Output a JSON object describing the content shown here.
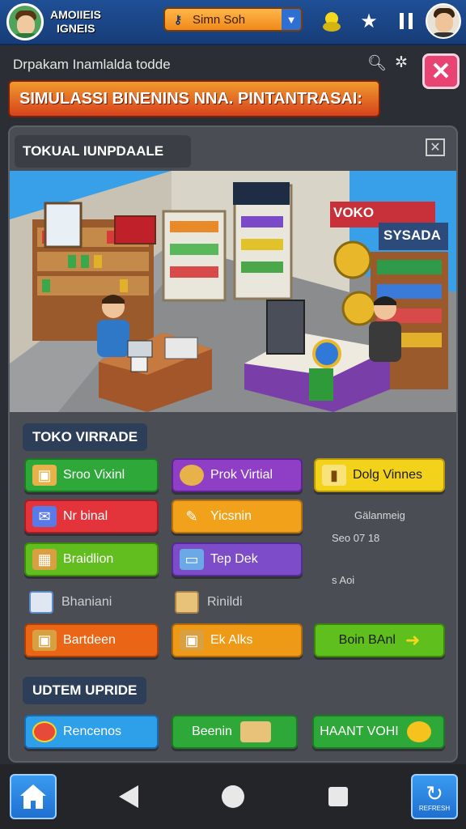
{
  "header": {
    "app_title_line1": "AMOIIEIS",
    "app_title_line2": "IGNEIS",
    "coin_label": "Simn Soh",
    "coin_icon": "key-icon",
    "icons": [
      "flame-icon",
      "star-icon",
      "pause-icon"
    ]
  },
  "subheader": {
    "text": "Drpakam Inamlalda todde",
    "banner": "SIMULASSI BINENINS NNA. PINTANTRASAI:"
  },
  "panel": {
    "title": "TOKUAL IUNPDAALE",
    "scene_signs": [
      "VOKO",
      "SYSADA"
    ]
  },
  "section1": {
    "label": "TOKO VIRRADE",
    "buttons": [
      {
        "label": "Sroo Vixinl",
        "color": "#2fa83a",
        "icon": "box-icon"
      },
      {
        "label": "Prok Virtial",
        "color": "#8e3fc6",
        "icon": "coin-stack-icon"
      },
      {
        "label": "Dolg Vinnes",
        "color": "#f2d21a",
        "icon": "bottle-icon"
      },
      {
        "label": "Nr binal",
        "color": "#e2343a",
        "icon": "mail-icon"
      },
      {
        "label": "Yicsnin",
        "color": "#f2a21a",
        "icon": "wrench-icon"
      },
      {
        "label": "Braidlion",
        "color": "#62bd1e",
        "icon": "crate-icon"
      },
      {
        "label": "Tep Dek",
        "color": "#7d4cc8",
        "icon": "picture-icon"
      },
      {
        "label": "Bartdeen",
        "color": "#ea6616",
        "icon": "box-open-icon"
      },
      {
        "label": "Ek Alks",
        "color": "#ef9a16",
        "icon": "package-icon"
      },
      {
        "label": "Boin BAnl",
        "color": "#5fbf1c",
        "icon": "arrow-right-icon"
      }
    ],
    "plain_items": [
      {
        "label": "Bhaniani",
        "icon": "document-icon"
      },
      {
        "label": "Rinildi",
        "icon": "bag-icon"
      }
    ],
    "stats": {
      "line1": "Gälanmeig",
      "line2": "Seo 07 18",
      "line3": "s Aoi"
    }
  },
  "section2": {
    "label": "UDTEM UPRIDE",
    "buttons": [
      {
        "label": "Rencenos",
        "color": "#2ea0ea",
        "icon": "badge-icon"
      },
      {
        "label": "Beenin",
        "color": "#2fa83a",
        "icon": "tag-icon"
      },
      {
        "label": "HAANT VOHI",
        "color": "#2fa83a",
        "icon": "coin-icon"
      }
    ]
  },
  "nav": {
    "refresh_label": "REFRESH",
    "home_icon": "home-icon"
  },
  "colors": {
    "topbar": "#1f4f96",
    "banner": "#e0601f",
    "close": "#e84372",
    "panel": "#4a4d54"
  }
}
